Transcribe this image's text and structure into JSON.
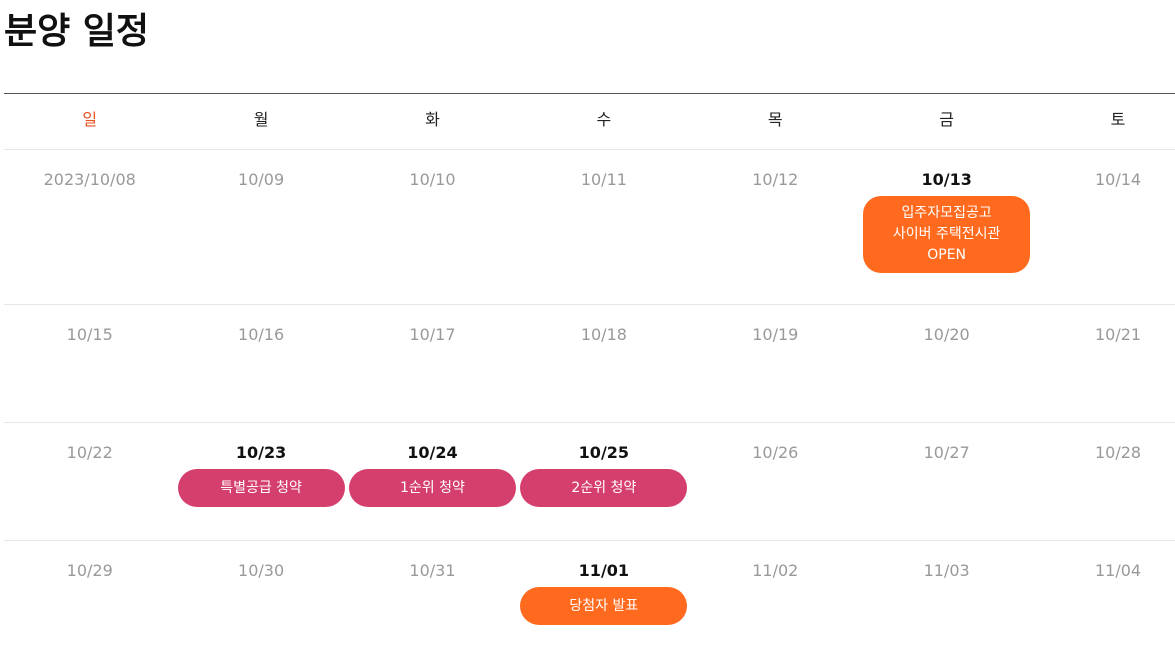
{
  "page": {
    "title": "분양 일정"
  },
  "weekdays": [
    "일",
    "월",
    "화",
    "수",
    "목",
    "금",
    "토"
  ],
  "colors": {
    "sunday": "#e8531f",
    "event_orange": "#ff6a1e",
    "event_pink": "#d53f6d",
    "muted_date": "#999999",
    "active_date": "#111111"
  },
  "weeks": [
    {
      "days": [
        {
          "date": "2023/10/08"
        },
        {
          "date": "10/09"
        },
        {
          "date": "10/10"
        },
        {
          "date": "10/11"
        },
        {
          "date": "10/12"
        },
        {
          "date": "10/13",
          "event": {
            "label": "입주자모집공고\n사이버 주택전시관\nOPEN",
            "color": "orange"
          }
        },
        {
          "date": "10/14"
        }
      ]
    },
    {
      "days": [
        {
          "date": "10/15"
        },
        {
          "date": "10/16"
        },
        {
          "date": "10/17"
        },
        {
          "date": "10/18"
        },
        {
          "date": "10/19"
        },
        {
          "date": "10/20"
        },
        {
          "date": "10/21"
        }
      ]
    },
    {
      "days": [
        {
          "date": "10/22"
        },
        {
          "date": "10/23",
          "event": {
            "label": "특별공급 청약",
            "color": "pink"
          }
        },
        {
          "date": "10/24",
          "event": {
            "label": "1순위 청약",
            "color": "pink"
          }
        },
        {
          "date": "10/25",
          "event": {
            "label": "2순위 청약",
            "color": "pink"
          }
        },
        {
          "date": "10/26"
        },
        {
          "date": "10/27"
        },
        {
          "date": "10/28"
        }
      ]
    },
    {
      "days": [
        {
          "date": "10/29"
        },
        {
          "date": "10/30"
        },
        {
          "date": "10/31"
        },
        {
          "date": "11/01",
          "event": {
            "label": "당첨자 발표",
            "color": "orange"
          }
        },
        {
          "date": "11/02"
        },
        {
          "date": "11/03"
        },
        {
          "date": "11/04"
        }
      ]
    }
  ]
}
